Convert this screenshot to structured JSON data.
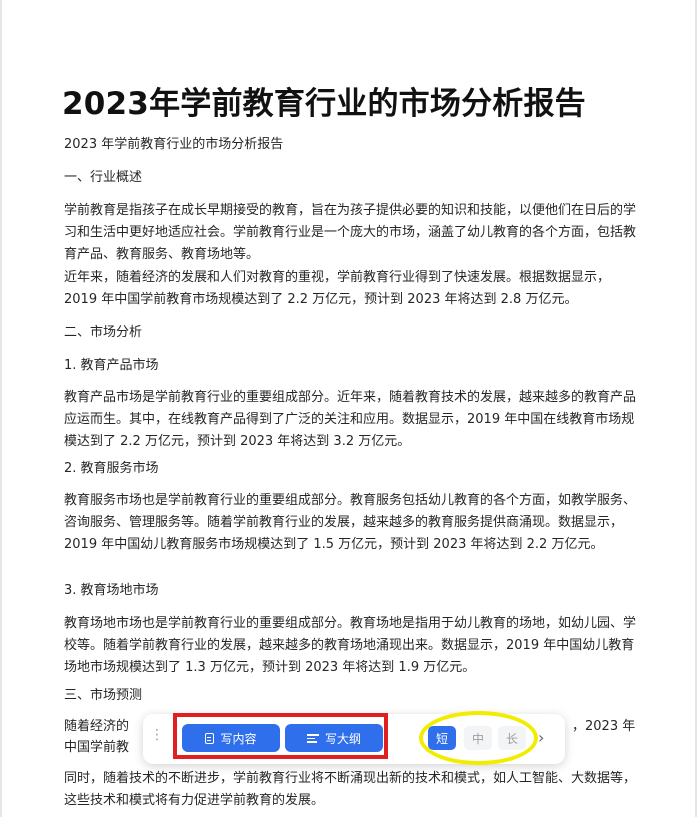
{
  "document": {
    "title": "2023年学前教育行业的市场分析报告",
    "paragraphs": [
      "2023 年学前教育行业的市场分析报告",
      "一、行业概述",
      "学前教育是指孩子在成长早期接受的教育，旨在为孩子提供必要的知识和技能，以便他们在日后的学习和生活中更好地适应社会。学前教育行业是一个庞大的市场，涵盖了幼儿教育的各个方面，包括教育产品、教育服务、教育场地等。",
      "近年来，随着经济的发展和人们对教育的重视，学前教育行业得到了快速发展。根据数据显示，2019 年中国学前教育市场规模达到了 2.2 万亿元，预计到 2023 年将达到 2.8 万亿元。",
      "二、市场分析",
      "1. 教育产品市场",
      "教育产品市场是学前教育行业的重要组成部分。近年来，随着教育技术的发展，越来越多的教育产品应运而生。其中，在线教育产品得到了广泛的关注和应用。数据显示，2019 年中国在线教育市场规模达到了 2.2 万亿元，预计到 2023 年将达到 3.2 万亿元。",
      "2. 教育服务市场",
      "教育服务市场也是学前教育行业的重要组成部分。教育服务包括幼儿教育的各个方面，如教学服务、咨询服务、管理服务等。随着学前教育行业的发展，越来越多的教育服务提供商涌现。数据显示，2019 年中国幼儿教育服务市场规模达到了 1.5 万亿元，预计到 2023 年将达到 2.2 万亿元。",
      "3. 教育场地市场",
      "教育场地市场也是学前教育行业的重要组成部分。教育场地是指用于幼儿教育的场地，如幼儿园、学校等。随着学前教育行业的发展，越来越多的教育场地涌现出来。数据显示，2019 年中国幼儿教育场地市场规模达到了 1.3 万亿元，预计到 2023 年将达到 1.9 万亿元。",
      "三、市场预测",
      "随着经济的",
      "，2023 年",
      "中国学前教",
      "同时，随着技术的不断进步，学前教育行业将不断涌现出新的技术和模式，如人工智能、大数据等，这些技术和模式将有力促进学前教育的发展。"
    ]
  },
  "toolbar": {
    "write_content_label": "写内容",
    "write_outline_label": "写大纲",
    "length_options": [
      "短",
      "中",
      "长"
    ],
    "selected_length": "短",
    "more_glyph": "›",
    "drag_glyph": "⋮"
  },
  "colors": {
    "accent": "#2f6fec",
    "annotation_red": "#e02020",
    "annotation_yellow": "#f2ec00"
  }
}
